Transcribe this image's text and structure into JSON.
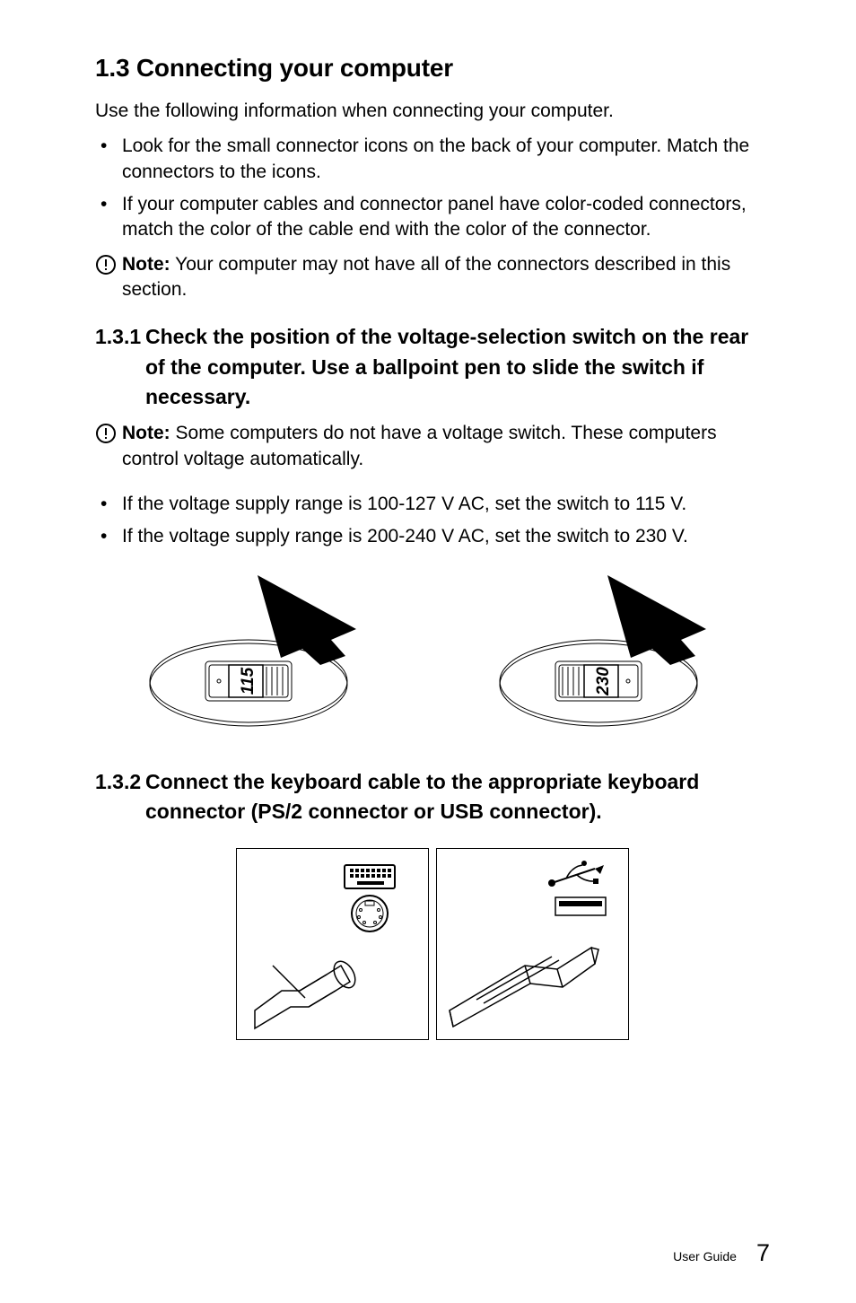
{
  "section": {
    "title": "1.3 Connecting your computer",
    "intro": "Use the following information when connecting your computer.",
    "bullets": [
      "Look for the small connector icons on the back of your computer. Match the connectors to the icons.",
      "If your computer cables and connector panel have color-coded connectors, match the color of the cable end with the color of the connector."
    ],
    "note1": {
      "label": "Note:",
      "body": " Your computer may not have all of the connectors described in this section."
    },
    "sub1": {
      "num": "1.3.1",
      "title": "Check the position of the voltage-selection switch on the rear of the computer. Use a ballpoint pen to slide the switch if necessary.",
      "note": {
        "label": "Note:",
        "body": " Some computers do not have a voltage switch. These computers control voltage automatically."
      },
      "bullets": [
        "If the voltage supply range is 100-127 V AC, set the switch to 115 V.",
        "If the voltage supply range is 200-240 V AC, set the switch to 230 V."
      ],
      "switch_labels": [
        "115",
        "230"
      ]
    },
    "sub2": {
      "num": "1.3.2",
      "title": "Connect the keyboard cable to the appropriate keyboard connector (PS/2 connector or USB connector)."
    }
  },
  "footer": {
    "label": "User Guide",
    "page": "7"
  }
}
